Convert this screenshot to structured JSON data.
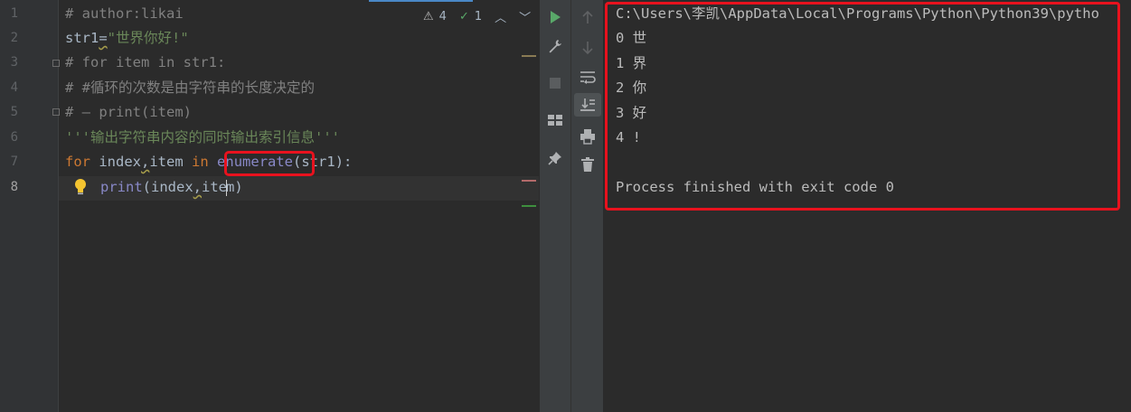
{
  "editor": {
    "line_numbers": [
      "1",
      "2",
      "3",
      "4",
      "5",
      "6",
      "7",
      "8"
    ],
    "lines": {
      "l1": "# author:likai",
      "l2_var": "str1",
      "l2_eq": "=",
      "l2_str": "\"世界你好!\"",
      "l3": "# for item in str1:",
      "l4": "# #循环的次数是由字符串的长度决定的",
      "l5": "# — print(item)",
      "l6": "'''输出字符串内容的同时输出索引信息'''",
      "l7_for": "for",
      "l7_a": " index",
      "l7_comma": ",",
      "l7_b": "item ",
      "l7_in": "in",
      "l7_sp": " ",
      "l7_fn": "enumerate",
      "l7_rest": "(str1):",
      "l8_fn": "print",
      "l8_a": "(index",
      "l8_comma": ",",
      "l8_b1": "ite",
      "l8_b2": "m)"
    },
    "inspection": {
      "warnings": "4",
      "ok": "1"
    },
    "colors": {
      "keyword": "#cc7832",
      "string": "#6a8759",
      "comment": "#808080",
      "builtin": "#8888c6",
      "highlight": "#e8121e"
    }
  },
  "toolbar": {
    "run_icon": "run-icon",
    "wrench_icon": "wrench-icon",
    "stop_icon": "stop-icon",
    "layout_icon": "layout-icon",
    "pin_icon": "pin-icon",
    "up_icon": "arrow-up-icon",
    "down_icon": "arrow-down-icon",
    "wrap_icon": "soft-wrap-icon",
    "scroll_end_icon": "scroll-to-end-icon",
    "print_icon": "print-icon",
    "trash_icon": "trash-icon"
  },
  "console": {
    "command": "C:\\Users\\李凯\\AppData\\Local\\Programs\\Python\\Python39\\pytho",
    "output": [
      "0 世",
      "1 界",
      "2 你",
      "3 好",
      "4 !"
    ],
    "finished": "Process finished with exit code 0"
  }
}
